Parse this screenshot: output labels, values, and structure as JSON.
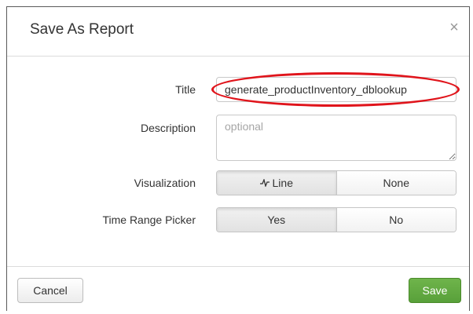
{
  "dialog": {
    "title": "Save As Report",
    "close_symbol": "×"
  },
  "form": {
    "title_label": "Title",
    "title_value": "generate_productInventory_dblookup",
    "description_label": "Description",
    "description_placeholder": "optional",
    "description_value": "",
    "visualization_label": "Visualization",
    "visualization_options": [
      "Line",
      "None"
    ],
    "visualization_selected": "Line",
    "time_range_label": "Time Range Picker",
    "time_range_options": [
      "Yes",
      "No"
    ],
    "time_range_selected": "Yes"
  },
  "footer": {
    "cancel_label": "Cancel",
    "save_label": "Save"
  },
  "colors": {
    "save_button": "#5aa23b",
    "highlight_ring": "#e0141b"
  },
  "icons": {
    "line_chart": "line-chart-icon",
    "close": "close-icon"
  }
}
